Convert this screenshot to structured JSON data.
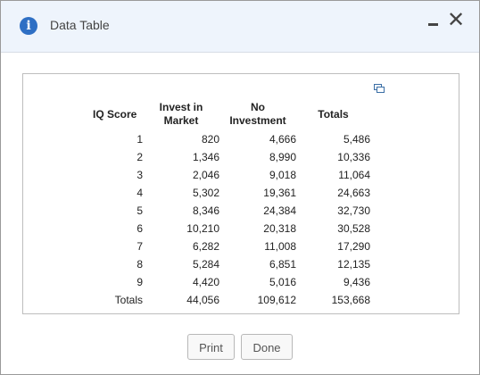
{
  "window": {
    "title": "Data Table",
    "info_icon_glyph": "i"
  },
  "table": {
    "headers": {
      "iq": "IQ Score",
      "invest_line1": "Invest in",
      "invest_line2": "Market",
      "noinv_line1": "No",
      "noinv_line2": "Investment",
      "totals": "Totals"
    },
    "rows": [
      {
        "iq": "1",
        "invest": "820",
        "no_invest": "4,666",
        "total": "5,486"
      },
      {
        "iq": "2",
        "invest": "1,346",
        "no_invest": "8,990",
        "total": "10,336"
      },
      {
        "iq": "3",
        "invest": "2,046",
        "no_invest": "9,018",
        "total": "11,064"
      },
      {
        "iq": "4",
        "invest": "5,302",
        "no_invest": "19,361",
        "total": "24,663"
      },
      {
        "iq": "5",
        "invest": "8,346",
        "no_invest": "24,384",
        "total": "32,730"
      },
      {
        "iq": "6",
        "invest": "10,210",
        "no_invest": "20,318",
        "total": "30,528"
      },
      {
        "iq": "7",
        "invest": "6,282",
        "no_invest": "11,008",
        "total": "17,290"
      },
      {
        "iq": "8",
        "invest": "5,284",
        "no_invest": "6,851",
        "total": "12,135"
      },
      {
        "iq": "9",
        "invest": "4,420",
        "no_invest": "5,016",
        "total": "9,436"
      },
      {
        "iq": "Totals",
        "invest": "44,056",
        "no_invest": "109,612",
        "total": "153,668"
      }
    ]
  },
  "buttons": {
    "print": "Print",
    "done": "Done"
  }
}
